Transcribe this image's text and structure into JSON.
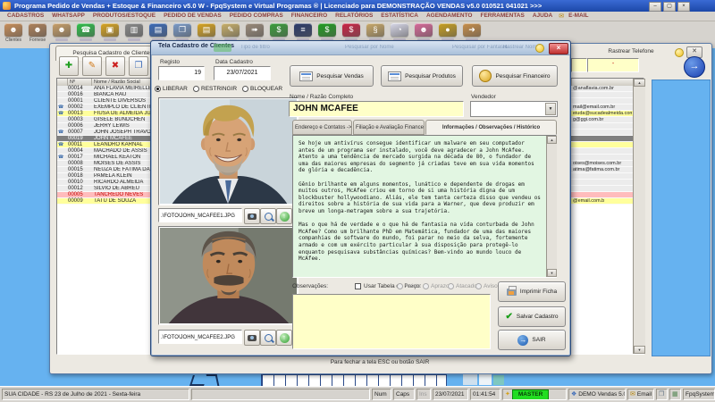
{
  "window": {
    "title": "Programa Pedido de Vendas + Estoque & Financeiro v5.0 W - FpqSystem e Virtual Programas ® | Licenciado para  DEMONSTRAÇÃO VENDAS v5.0 010521 041021 >>>"
  },
  "menu": {
    "items": [
      "CADASTROS",
      "WHATSAPP",
      "PRODUTOS/ESTOQUE",
      "PEDIDO DE VENDAS",
      "PEDIDO COMPRAS",
      "FINANCEIRO",
      "RELATÓRIOS",
      "ESTATÍSTICA",
      "AGENDAMENTO",
      "FERRAMENTAS",
      "AJUDA",
      "E-MAIL"
    ]
  },
  "toolbar": {
    "icons": [
      {
        "name": "clientes-icon",
        "glyph": "☻",
        "color": "#c98f5a",
        "label": "Clientes"
      },
      {
        "name": "fornecedores-icon",
        "glyph": "☻",
        "color": "#b0825a",
        "label": "Fornese"
      },
      {
        "name": "vendedores-icon",
        "glyph": "☻",
        "color": "#c9a06a",
        "label": ""
      },
      {
        "name": "whatsapp-icon",
        "glyph": "☎",
        "color": "#2fbf4a",
        "label": ""
      },
      {
        "name": "produtos-icon",
        "glyph": "▣",
        "color": "#d9a520",
        "label": ""
      },
      {
        "name": "codigo-barras-icon",
        "glyph": "▥",
        "color": "#8a8a8a",
        "label": ""
      },
      {
        "name": "caixa-monitor-icon",
        "glyph": "▤",
        "color": "#3a6ab8",
        "label": ""
      },
      {
        "name": "orcamento-doc-icon",
        "glyph": "❐",
        "color": "#7a9ac8",
        "label": ""
      },
      {
        "name": "pedidos-pasta-icon",
        "glyph": "▤",
        "color": "#d9a520",
        "label": ""
      },
      {
        "name": "anotacoes-icon",
        "glyph": "✎",
        "color": "#c9b06a",
        "label": ""
      },
      {
        "name": "entregas-icon",
        "glyph": "➠",
        "color": "#9a8a7a",
        "label": ""
      },
      {
        "name": "financeiro-grafico-icon",
        "glyph": "$",
        "color": "#3a9e3a",
        "label": ""
      },
      {
        "name": "carteira-icon",
        "glyph": "≡",
        "color": "#2a3a6a",
        "label": ""
      },
      {
        "name": "receber-icon",
        "glyph": "$",
        "color": "#1f9e1f",
        "label": ""
      },
      {
        "name": "pagar-icon",
        "glyph": "$",
        "color": "#cc2244",
        "label": ""
      },
      {
        "name": "recibos-icon",
        "glyph": "§",
        "color": "#c9a96a",
        "label": ""
      },
      {
        "name": "agendamento-relogio-icon",
        "glyph": "◔",
        "color": "#d8d8e8",
        "label": ""
      },
      {
        "name": "atendimento-icon",
        "glyph": "☻",
        "color": "#d86a9a",
        "label": ""
      },
      {
        "name": "moedas-icon",
        "glyph": "●",
        "color": "#c9a020",
        "label": ""
      },
      {
        "name": "sair-porta-icon",
        "glyph": "➜",
        "color": "#c98f4a",
        "label": ""
      }
    ]
  },
  "pesquisa": {
    "tab_title": "Pesquisa Cadastro de Clientes",
    "footer_hint": "Para fechar a tela ESC ou botão SAIR",
    "rastrear": {
      "label": "Rastrear Telefone",
      "value": "-"
    },
    "grid": {
      "headers": {
        "num": "Nº",
        "name": "Nome / Razão Social"
      },
      "rows": [
        {
          "num": "00014",
          "name": "ANA FLAVIA MEIRELLE",
          "phone": false,
          "state": "none",
          "email": "@anaflavia.com.br"
        },
        {
          "num": "00016",
          "name": "BIANCA RAU",
          "phone": false,
          "state": "none",
          "email": ""
        },
        {
          "num": "00001",
          "name": "CLIENTE DIVERSOS",
          "phone": false,
          "state": "none",
          "email": ""
        },
        {
          "num": "00002",
          "name": "EXEMPLO DE CLIENTE",
          "phone": true,
          "state": "none",
          "email": "mail@email.com.br"
        },
        {
          "num": "00013",
          "name": "FIUSA DE ALMEIDA JU",
          "phone": true,
          "state": "yellow",
          "email": "eiuda@sucadealmeida.com.br"
        },
        {
          "num": "00003",
          "name": "GISELE BUNDCHEN",
          "phone": false,
          "state": "none",
          "email": "g@ggi.com.br"
        },
        {
          "num": "00006",
          "name": "JERRY LEWIS",
          "phone": false,
          "state": "none",
          "email": ""
        },
        {
          "num": "00007",
          "name": "JOHN JOSEPH TRAVOL",
          "phone": true,
          "state": "none",
          "email": ""
        },
        {
          "num": "00019",
          "name": "JOHN MCAFEE",
          "phone": false,
          "state": "selected",
          "email": ""
        },
        {
          "num": "00011",
          "name": "LEANDRO KARNAL",
          "phone": true,
          "state": "yellow",
          "email": ""
        },
        {
          "num": "00004",
          "name": "MACHADO DE ASSIS",
          "phone": false,
          "state": "none",
          "email": ""
        },
        {
          "num": "00017",
          "name": "MICHAEL KEATON",
          "phone": true,
          "state": "none",
          "email": ""
        },
        {
          "num": "00008",
          "name": "MOISES DE ASSIS",
          "phone": false,
          "state": "none",
          "email": "oises@moises.com.br"
        },
        {
          "num": "00015",
          "name": "NEUZA DE FATIMA DA",
          "phone": false,
          "state": "none",
          "email": "atima@fatima.com.br"
        },
        {
          "num": "00018",
          "name": "PAMELA KLEIN",
          "phone": false,
          "state": "none",
          "email": ""
        },
        {
          "num": "00010",
          "name": "RICARDO ALMEIDA",
          "phone": false,
          "state": "none",
          "email": ""
        },
        {
          "num": "00012",
          "name": "SILVIO DE ABREU",
          "phone": false,
          "state": "none",
          "email": ""
        },
        {
          "num": "00005",
          "name": "TANCREDO NEVES",
          "phone": false,
          "state": "pink",
          "email": ""
        },
        {
          "num": "00009",
          "name": "TATU DE SOUZA",
          "phone": false,
          "state": "yellow",
          "email": "@email.com.b"
        }
      ]
    }
  },
  "dialog": {
    "title": "Tela Cadastro de Clientes",
    "ghost_labels": [
      "Tipo de filtro",
      "Pesquisar por Nome",
      "Pesquisar por Fantasia",
      "Rastrear Nome"
    ],
    "registro": {
      "label": "Registo",
      "value": "19"
    },
    "data_cadastro": {
      "label": "Data Cadastro",
      "value": "23/07/2021"
    },
    "radios": [
      {
        "label": "LIBERAR",
        "selected": true
      },
      {
        "label": "RESTRINGIR",
        "selected": false
      },
      {
        "label": "BLOQUEAR",
        "selected": false
      }
    ],
    "photos": [
      {
        "path": ".\\FOTO\\JOHN_MCAFEE1.JPG"
      },
      {
        "path": ".\\FOTO\\JOHN_MCAFEE2.JPG"
      }
    ],
    "buttons_top": [
      "Pesquisar Vendas",
      "Pesquisar Produtos",
      "Pesquisar Financeiro"
    ],
    "nome": {
      "label": "Nome / Razão Completo",
      "value": "JOHN MCAFEE"
    },
    "vendedor": {
      "label": "Vendedor",
      "value": ""
    },
    "tabs": [
      "Endereço e Contatos ->",
      "Filiação e Avaliação Financeira ->",
      "Informações / Observações / Histórico"
    ],
    "active_tab": 2,
    "bio": {
      "p1": "Se hoje um antivírus consegue identificar um malware em seu computador antes de um programa ser instalado, você deve agradecer a John McAfee. Atento a uma tendência de mercado surgida na década de 80, o fundador de uma das maiores empresas do segmento já criadas teve em sua vida momentos de glória e decadência.",
      "p2": "Gênio brilhante em alguns momentos, lunático e dependente de drogas em muitos outros, McAfee criou em torno de si uma história digna de um blockbuster hollywoodiano. Aliás, ele tem tanta certeza disso que vendeu os direitos sobre a história de sua vida para a Warner, que deve produzir em breve um longa-metragem sobre a sua trajetória.",
      "p3": "Mas o que há de verdade e o que há de fantasia na vida conturbada de John McAfee? Como um brilhante PhD em Matemática, fundador de uma das maiores companhias de software do mundo, foi parar no meio da selva, fortemente armado e com um exército particular à sua disposição para protegê-lo enquanto pesquisava substâncias químicas? Bem-vindo ao mundo louco de McAfee."
    },
    "observacoes_label": "Observações:",
    "price_table": {
      "checkbox_label": "Usar Tabela de Preço:",
      "options": [
        "Avista",
        "Aprazo",
        "Atacado",
        "Aviso"
      ]
    },
    "action_buttons": [
      "Imprimir Ficha",
      "Salvar Cadastro",
      "SAIR"
    ]
  },
  "statusbar": {
    "location": "SUA CIDADE - RS  23 de Julho de 2021 - Sexta-feira",
    "num": "Num",
    "caps": "Caps",
    "ins": "Ins",
    "date": "23/07/2021",
    "time": "01:41:54",
    "user": "MASTER",
    "version": "DEMO Vendas 5.0",
    "email": "Email",
    "brand": "FpqSystem"
  },
  "colors": {
    "desktop": "#66b2f0",
    "selected_row": "#7f7f7f",
    "yellow_row": "#ffff9c",
    "pink_row": "#ffbcbc",
    "field_yellow": "#ffffc8",
    "bio_green": "#e2f6e2",
    "master_green": "#22dd22"
  }
}
